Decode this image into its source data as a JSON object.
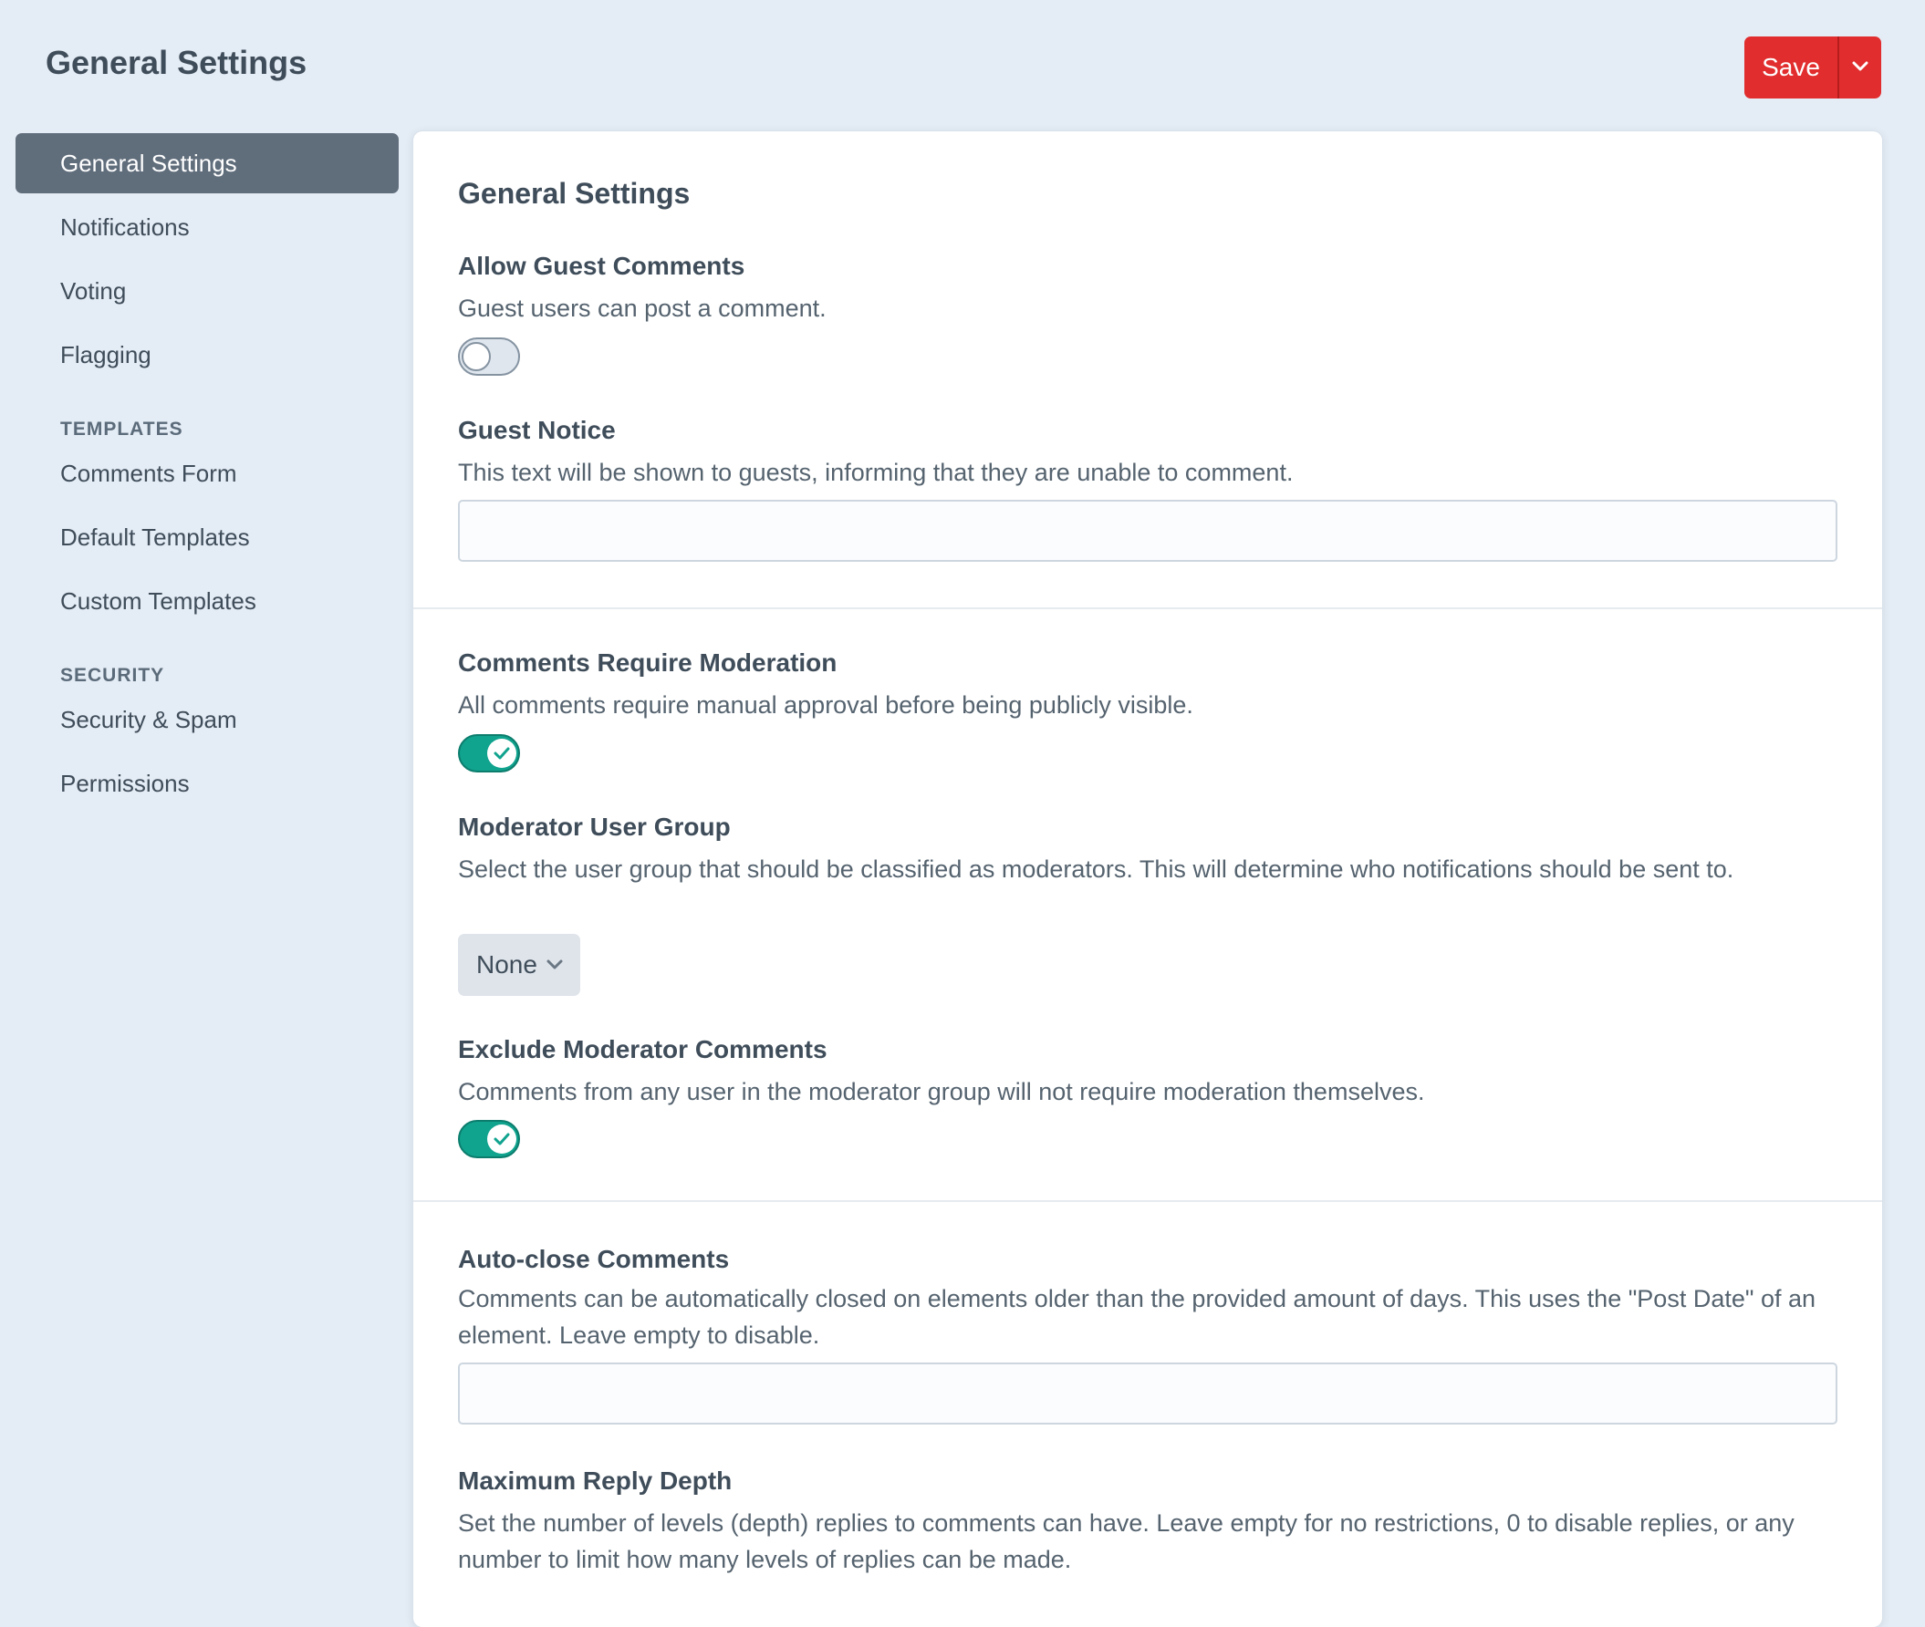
{
  "header": {
    "title": "General Settings",
    "save_label": "Save"
  },
  "sidebar": {
    "items": [
      {
        "label": "General Settings",
        "active": true
      },
      {
        "label": "Notifications"
      },
      {
        "label": "Voting"
      },
      {
        "label": "Flagging"
      }
    ],
    "templates_heading": "TEMPLATES",
    "templates_items": [
      {
        "label": "Comments Form"
      },
      {
        "label": "Default Templates"
      },
      {
        "label": "Custom Templates"
      }
    ],
    "security_heading": "SECURITY",
    "security_items": [
      {
        "label": "Security & Spam"
      },
      {
        "label": "Permissions"
      }
    ]
  },
  "main": {
    "title": "General Settings",
    "fields": {
      "allow_guest_comments": {
        "label": "Allow Guest Comments",
        "description": "Guest users can post a comment.",
        "enabled": false
      },
      "guest_notice": {
        "label": "Guest Notice",
        "description": "This text will be shown to guests, informing that they are unable to comment.",
        "value": ""
      },
      "require_moderation": {
        "label": "Comments Require Moderation",
        "description": "All comments require manual approval before being publicly visible.",
        "enabled": true
      },
      "moderator_group": {
        "label": "Moderator User Group",
        "description": "Select the user group that should be classified as moderators. This will determine who notifications should be sent to.",
        "selected": "None"
      },
      "exclude_moderator": {
        "label": "Exclude Moderator Comments",
        "description": "Comments from any user in the moderator group will not require moderation themselves.",
        "enabled": true
      },
      "auto_close": {
        "label": "Auto-close Comments",
        "description": "Comments can be automatically closed on elements older than the provided amount of days. This uses the \"Post Date\" of an element. Leave empty to disable.",
        "value": ""
      },
      "max_reply_depth": {
        "label": "Maximum Reply Depth",
        "description": "Set the number of levels (depth) replies to comments can have. Leave empty for no restrictions, 0 to disable replies, or any number to limit how many levels of replies can be made."
      }
    }
  },
  "colors": {
    "accent_red": "#e12d2d",
    "toggle_on": "#10a38e",
    "sidebar_active": "#606d7b",
    "background": "#e4ecf5"
  }
}
